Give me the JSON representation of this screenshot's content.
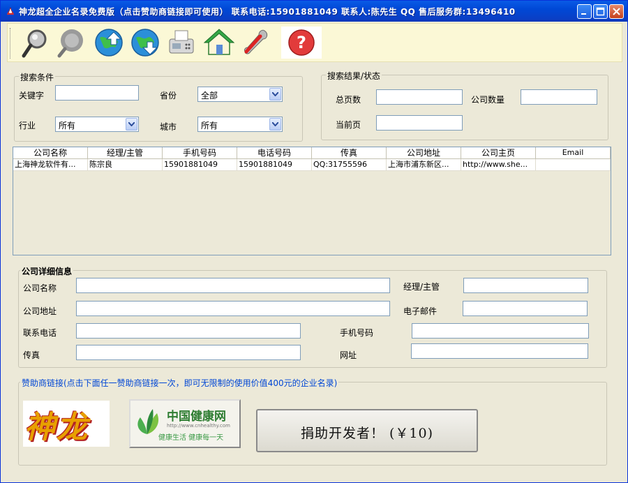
{
  "window": {
    "title": "神龙超全企业名录免费版（点击赞助商链接即可使用） 联系电话:15901881049 联系人:陈先生 QQ 售后服务群:13496410"
  },
  "toolbar": {
    "icons": [
      "search-icon",
      "search-disabled-icon",
      "import-globe-icon",
      "export-globe-icon",
      "fax-icon",
      "home-icon",
      "tools-icon",
      "help-icon"
    ]
  },
  "search": {
    "legend": "搜索条件",
    "keyword_label": "关键字",
    "keyword_value": "",
    "province_label": "省份",
    "province_value": "全部",
    "industry_label": "行业",
    "industry_value": "所有",
    "city_label": "城市",
    "city_value": "所有"
  },
  "result": {
    "legend": "搜索结果/状态",
    "total_pages_label": "总页数",
    "total_pages_value": "",
    "company_count_label": "公司数量",
    "company_count_value": "",
    "current_page_label": "当前页",
    "current_page_value": ""
  },
  "table": {
    "columns": [
      "公司名称",
      "经理/主管",
      "手机号码",
      "电话号码",
      "传真",
      "公司地址",
      "公司主页",
      "Email"
    ],
    "rows": [
      [
        "上海神龙软件有...",
        "陈宗良",
        "15901881049",
        "15901881049",
        "QQ:31755596",
        "上海市浦东新区...",
        "http://www.she...",
        ""
      ]
    ]
  },
  "detail": {
    "legend": "公司详细信息",
    "company_name_label": "公司名称",
    "company_name_value": "",
    "manager_label": "经理/主管",
    "manager_value": "",
    "address_label": "公司地址",
    "address_value": "",
    "email_label": "电子邮件",
    "email_value": "",
    "phone_label": "联系电话",
    "phone_value": "",
    "mobile_label": "手机号码",
    "mobile_value": "",
    "fax_label": "传真",
    "fax_value": "",
    "website_label": "网址",
    "website_value": ""
  },
  "sponsor": {
    "legend": "赞助商链接(点击下面任一赞助商链接一次，即可无限制的使用价值400元的企业名录)",
    "shenlong_logo": "神龙",
    "health_title": "中国健康网",
    "health_url": "http://www.cnhealthy.com",
    "health_slogan": "健康生活 健康每一天",
    "donate_label": "捐助开发者！ (￥10)"
  },
  "colors": {
    "titlebar": "#0a48d6",
    "window_bg": "#ece9d8",
    "toolbar_bg": "#fbf8d6",
    "legend_blue": "#0046d5"
  }
}
